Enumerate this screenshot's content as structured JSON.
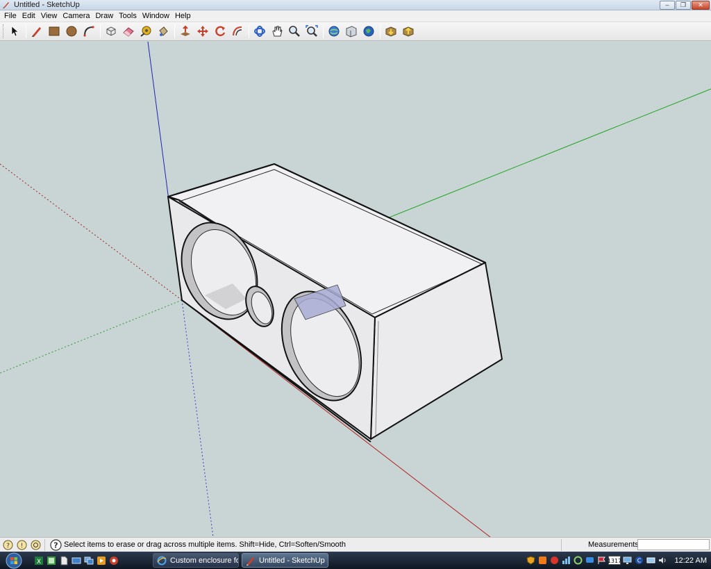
{
  "window": {
    "title": "Untitled - SketchUp",
    "controls": {
      "minimize": "–",
      "restore": "❐",
      "close": "✕"
    }
  },
  "menu": {
    "items": [
      "File",
      "Edit",
      "View",
      "Camera",
      "Draw",
      "Tools",
      "Window",
      "Help"
    ]
  },
  "toolbar": {
    "tools": [
      {
        "name": "select",
        "icon": "arrow-cursor-icon"
      },
      {
        "name": "line",
        "icon": "pencil-icon"
      },
      {
        "name": "rectangle",
        "icon": "rectangle-icon"
      },
      {
        "name": "circle",
        "icon": "circle-icon"
      },
      {
        "name": "arc",
        "icon": "arc-icon"
      },
      {
        "name": "make-component",
        "icon": "component-icon"
      },
      {
        "name": "eraser",
        "icon": "eraser-icon"
      },
      {
        "name": "tape-measure",
        "icon": "tape-measure-icon"
      },
      {
        "name": "paint-bucket",
        "icon": "paint-bucket-icon"
      },
      {
        "name": "push-pull",
        "icon": "push-pull-icon"
      },
      {
        "name": "move",
        "icon": "move-icon"
      },
      {
        "name": "rotate",
        "icon": "rotate-icon"
      },
      {
        "name": "offset",
        "icon": "offset-icon"
      },
      {
        "name": "orbit",
        "icon": "orbit-icon"
      },
      {
        "name": "pan",
        "icon": "pan-hand-icon"
      },
      {
        "name": "zoom",
        "icon": "zoom-icon"
      },
      {
        "name": "zoom-extents",
        "icon": "zoom-extents-icon"
      },
      {
        "name": "get-models",
        "icon": "get-models-icon"
      },
      {
        "name": "share-model",
        "icon": "share-model-icon"
      },
      {
        "name": "google-earth",
        "icon": "google-earth-icon"
      },
      {
        "name": "get-components",
        "icon": "get-components-icon"
      },
      {
        "name": "share-component",
        "icon": "share-component-icon"
      }
    ]
  },
  "status": {
    "message": "Select items to erase or drag across multiple items. Shift=Hide, Ctrl=Soften/Smooth",
    "measurements_label": "Measurements",
    "measurements_value": ""
  },
  "taskbar": {
    "tasks": [
      {
        "label": "Custom enclosure for...",
        "icon": "ie-icon",
        "active": false
      },
      {
        "label": "Untitled - SketchUp",
        "icon": "sketchup-icon",
        "active": true
      }
    ],
    "tray_badge": "1317",
    "clock": "12:22 AM"
  },
  "colors": {
    "viewport_bg": "#c8d5d4",
    "axis_red": "#b32020",
    "axis_green": "#22a322",
    "axis_blue": "#2222b0",
    "model_face": "#ededf0",
    "model_inner": "#b3b3b6",
    "port_tube": "#a9acd4"
  }
}
